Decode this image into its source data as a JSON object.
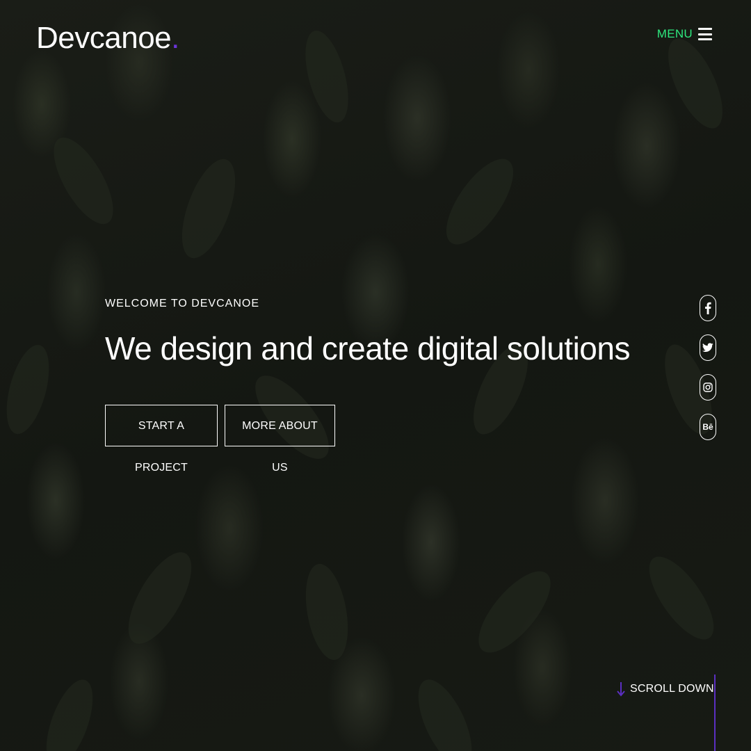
{
  "header": {
    "logo_text": "Devcanoe",
    "logo_dot": ".",
    "menu_label": "MENU"
  },
  "hero": {
    "eyebrow": "WELCOME TO DEVCANOE",
    "headline": "We design and create digital solutions",
    "buttons": {
      "start_project": "START A PROJECT",
      "more_about": "MORE ABOUT US"
    }
  },
  "social": [
    {
      "name": "facebook-icon"
    },
    {
      "name": "twitter-icon"
    },
    {
      "name": "instagram-icon"
    },
    {
      "name": "behance-icon",
      "glyph": "Bē"
    }
  ],
  "scroll": {
    "label": "SCROLL DOWN"
  },
  "colors": {
    "accent_green": "#2ee87e",
    "accent_purple": "#6b35d9",
    "background": "#141712"
  }
}
